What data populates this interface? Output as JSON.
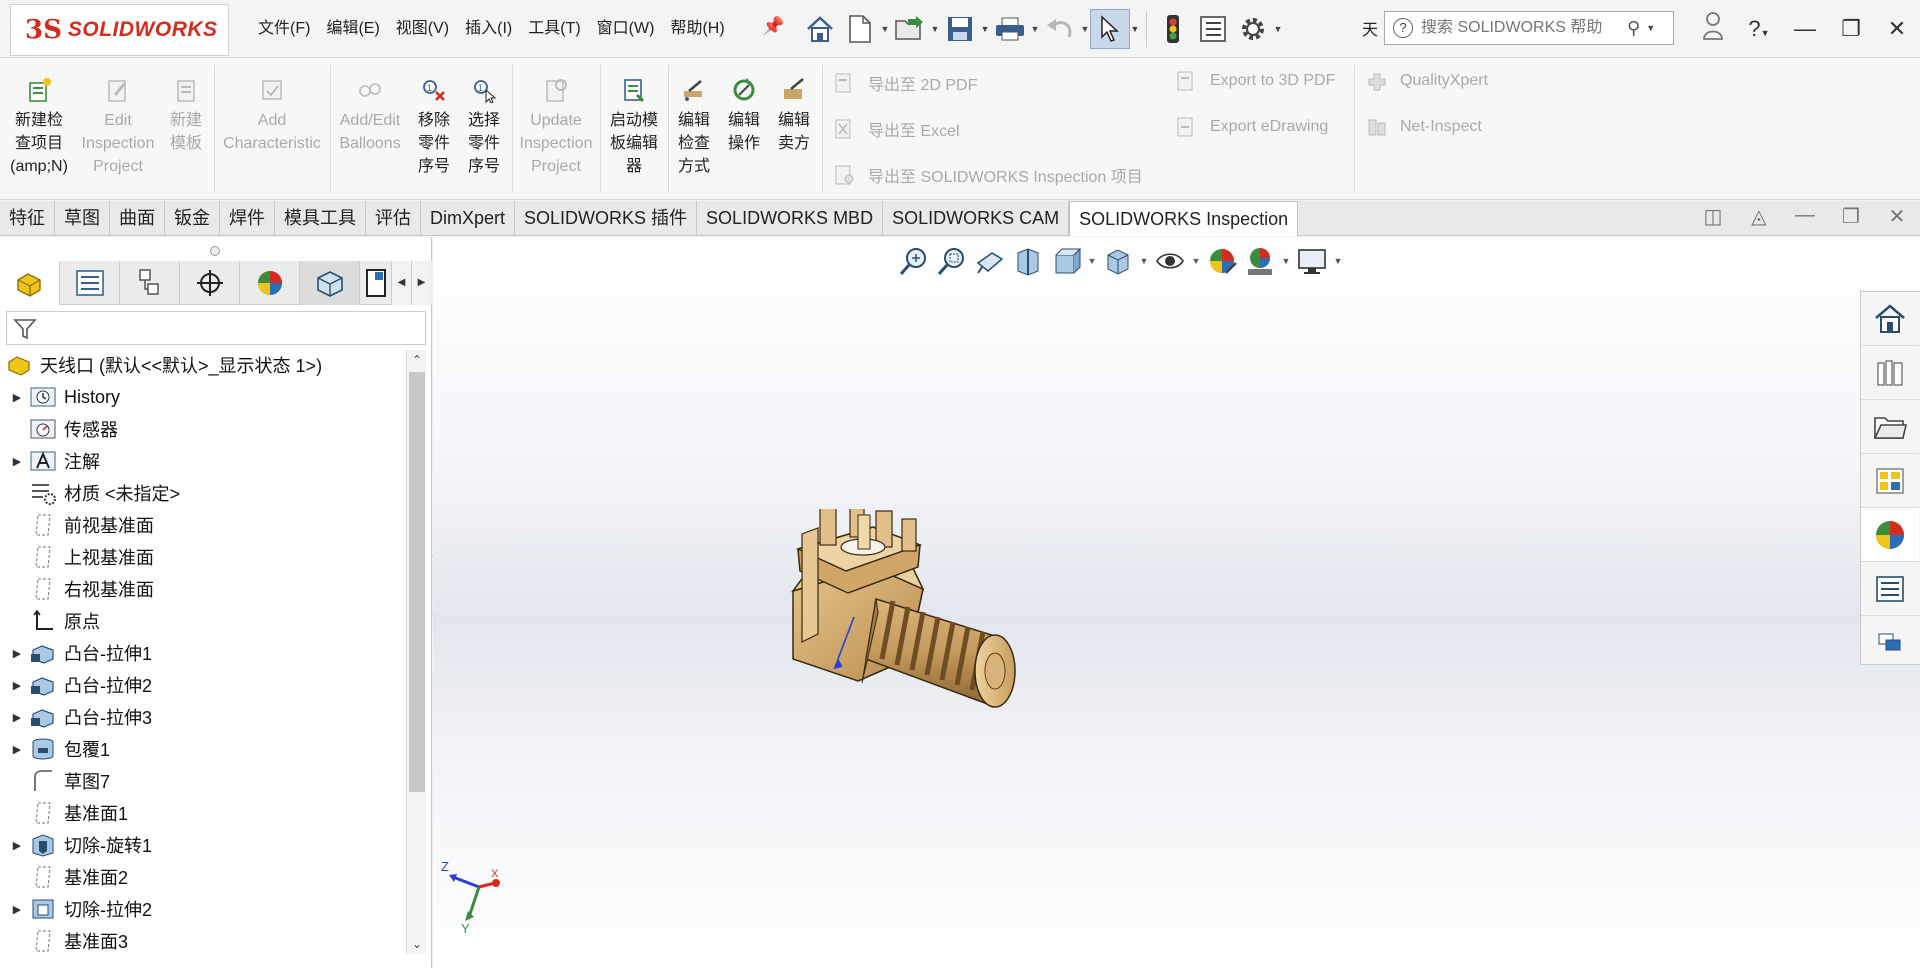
{
  "app": {
    "logo_mark": "3S",
    "logo_text": "SOLIDWORKS",
    "menu": [
      "文件(F)",
      "编辑(E)",
      "视图(V)",
      "插入(I)",
      "工具(T)",
      "窗口(W)",
      "帮助(H)"
    ],
    "quick_access_icons": [
      "home-icon",
      "new-document-icon",
      "open-icon",
      "save-icon",
      "print-icon",
      "undo-icon",
      "select-icon",
      "rebuild-icon",
      "file-properties-icon",
      "options-icon"
    ],
    "sky_label": "天",
    "search": {
      "placeholder": "搜索 SOLIDWORKS 帮助"
    }
  },
  "ribbon": {
    "buttons": [
      {
        "label": "新建检\n查项目\n(amp;N)",
        "enabled": true,
        "icon": "new-inspection-project-icon"
      },
      {
        "label": "Edit\nInspection\nProject",
        "enabled": false,
        "icon": "edit-inspection-project-icon"
      },
      {
        "label": "新建\n模板",
        "enabled": false,
        "icon": "new-template-icon"
      },
      {
        "label": "Add\nCharacteristic",
        "enabled": false,
        "icon": "add-characteristic-icon"
      },
      {
        "label": "Add/Edit\nBalloons",
        "enabled": false,
        "icon": "balloons-icon"
      },
      {
        "label": "移除\n零件\n序号",
        "enabled": true,
        "icon": "remove-balloon-icon"
      },
      {
        "label": "选择\n零件\n序号",
        "enabled": true,
        "icon": "select-balloon-icon"
      },
      {
        "label": "Update\nInspection\nProject",
        "enabled": false,
        "icon": "update-project-icon"
      },
      {
        "label": "启动模\n板编辑\n器",
        "enabled": true,
        "icon": "template-editor-icon"
      },
      {
        "label": "编辑\n检查\n方式",
        "enabled": true,
        "icon": "edit-method-icon"
      },
      {
        "label": "编辑\n操作",
        "enabled": true,
        "icon": "edit-operation-icon"
      },
      {
        "label": "编辑\n卖方",
        "enabled": true,
        "icon": "edit-vendor-icon"
      }
    ],
    "export_col1": [
      "导出至 2D PDF",
      "导出至 Excel",
      "导出至 SOLIDWORKS Inspection 项目"
    ],
    "export_col2": [
      "Export to 3D PDF",
      "Export eDrawing"
    ],
    "export_col3": [
      "QualityXpert",
      "Net-Inspect"
    ]
  },
  "command_tabs": [
    "特征",
    "草图",
    "曲面",
    "钣金",
    "焊件",
    "模具工具",
    "评估",
    "DimXpert",
    "SOLIDWORKS 插件",
    "SOLIDWORKS MBD",
    "SOLIDWORKS CAM",
    "SOLIDWORKS Inspection"
  ],
  "active_command_tab": "SOLIDWORKS Inspection",
  "panel_tabs": [
    "featuremanager-icon",
    "propertymanager-icon",
    "configurationmanager-icon",
    "dimxpert-icon",
    "display-manager-icon",
    "cam-feature-tree-icon",
    "cam-operation-icon"
  ],
  "feature_tree": {
    "root": "天线口  (默认<<默认>_显示状态 1>)",
    "items": [
      {
        "label": "History",
        "expandable": true,
        "icon": "history-icon"
      },
      {
        "label": "传感器",
        "expandable": false,
        "icon": "sensor-icon"
      },
      {
        "label": "注解",
        "expandable": true,
        "icon": "annotations-icon"
      },
      {
        "label": "材质 <未指定>",
        "expandable": false,
        "icon": "material-icon"
      },
      {
        "label": "前视基准面",
        "expandable": false,
        "icon": "plane-icon"
      },
      {
        "label": "上视基准面",
        "expandable": false,
        "icon": "plane-icon"
      },
      {
        "label": "右视基准面",
        "expandable": false,
        "icon": "plane-icon"
      },
      {
        "label": "原点",
        "expandable": false,
        "icon": "origin-icon"
      },
      {
        "label": "凸台-拉伸1",
        "expandable": true,
        "icon": "boss-extrude-icon"
      },
      {
        "label": "凸台-拉伸2",
        "expandable": true,
        "icon": "boss-extrude-icon"
      },
      {
        "label": "凸台-拉伸3",
        "expandable": true,
        "icon": "boss-extrude-icon"
      },
      {
        "label": "包覆1",
        "expandable": true,
        "icon": "wrap-icon"
      },
      {
        "label": "草图7",
        "expandable": false,
        "icon": "sketch-icon"
      },
      {
        "label": "基准面1",
        "expandable": false,
        "icon": "plane-icon"
      },
      {
        "label": "切除-旋转1",
        "expandable": true,
        "icon": "cut-revolve-icon"
      },
      {
        "label": "基准面2",
        "expandable": false,
        "icon": "plane-icon"
      },
      {
        "label": "切除-拉伸2",
        "expandable": true,
        "icon": "cut-extrude-icon"
      },
      {
        "label": "基准面3",
        "expandable": false,
        "icon": "plane-icon"
      }
    ]
  },
  "heads_up_toolbar": [
    "zoom-to-fit-icon",
    "zoom-to-area-icon",
    "previous-view-icon",
    "section-view-icon",
    "view-orientation-icon",
    "display-style-icon",
    "hide-show-items-icon",
    "edit-appearance-icon",
    "apply-scene-icon",
    "view-settings-icon"
  ],
  "task_pane": [
    "solidworks-resources-icon",
    "design-library-icon",
    "file-explorer-icon",
    "view-palette-icon",
    "appearances-icon",
    "custom-properties-icon",
    "forum-icon"
  ],
  "triad": {
    "x": "X",
    "y": "Y",
    "z": "Z"
  },
  "colors": {
    "accent": "#d52b1e",
    "brass": "#c9a56a",
    "selection": "#c9d7ea"
  }
}
